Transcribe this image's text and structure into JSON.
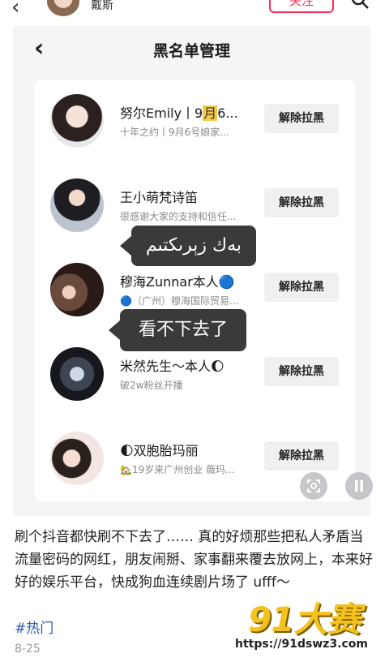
{
  "header": {
    "username": "戴斯",
    "follow_label": "关注"
  },
  "panel": {
    "title": "黑名单管理",
    "back_icon": "chevron-left-icon"
  },
  "blocked": [
    {
      "name_prefix": "努尔Emily丨9",
      "name_highlight": "月",
      "name_suffix": "6...",
      "desc": "十年之约丨9月6号娘家...",
      "button": "解除拉黑"
    },
    {
      "name": "王小萌梵诗笛",
      "desc": "很感谢大家的支持和信任...",
      "button": "解除拉黑"
    },
    {
      "name": "穆海Zunnar本人🔵",
      "desc": "🔵（广州）穆海国际贸易...",
      "button": "解除拉黑"
    },
    {
      "name": "米然先生～本人🌔",
      "desc": "破2w粉丝开播",
      "button": "解除拉黑"
    },
    {
      "name": "🌓双胞胎玛丽",
      "desc": "🏡19岁来广州创业  薇玛...",
      "button": "解除拉黑"
    }
  ],
  "bubbles": {
    "first": "بەك زېرىكتىم",
    "second": "看不下去了"
  },
  "post": {
    "text": "刷个抖音都快刷不下去了…… 真的好烦那些把私人矛盾当流量密码的网红，朋友闹掰、家事翻来覆去放网上，本来好好的娱乐平台，快成狗血连续剧片场了 ufff～",
    "hashtag": "#热门",
    "date": "8-25"
  },
  "watermark": {
    "logo": "91大赛",
    "url": "https://91dswz3.com"
  },
  "colors": {
    "accent": "#fe2c55",
    "hashtag": "#2a5db0",
    "bubble": "#3a3a3a",
    "watermark": "#f4c21c"
  }
}
